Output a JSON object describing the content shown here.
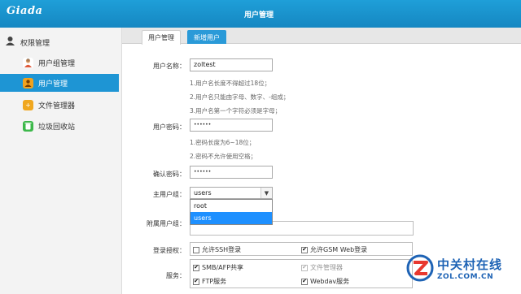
{
  "header": {
    "logo": "Giada",
    "title": "用户管理"
  },
  "sidebar": {
    "section": "权限管理",
    "items": [
      {
        "label": "用户组管理",
        "active": false
      },
      {
        "label": "用户管理",
        "active": true
      },
      {
        "label": "文件管理器",
        "active": false
      },
      {
        "label": "垃圾回收站",
        "active": false
      }
    ]
  },
  "tabs": {
    "current": "用户管理",
    "add": "新增用户"
  },
  "form": {
    "username_label": "用户名称：",
    "username_value": "zoltest",
    "username_hints": [
      "1.用户名长度不得超过18位；",
      "2.用户名只能由字母、数字、-组成；",
      "3.用户名第一个字符必须是字母；"
    ],
    "password_label": "用户密码：",
    "password_value": "••••••",
    "password_hints": [
      "1.密码长度为6~18位；",
      "2.密码不允许使用空格；"
    ],
    "confirm_label": "确认密码：",
    "confirm_value": "••••••",
    "group_label": "主用户组：",
    "group_value": "users",
    "group_options": [
      "root",
      "users"
    ],
    "subgroup_label": "附属用户组：",
    "login_label": "登录授权：",
    "login_ssh": "允许SSH登录",
    "login_gsm": "允许GSM Web登录",
    "service_label": "服务：",
    "svc_smb": "SMB/AFP共享",
    "svc_filemgr": "文件管理器",
    "svc_ftp": "FTP服务",
    "svc_webdav": "Webdav服务"
  },
  "watermark": {
    "cn": "中关村在线",
    "en": "ZOL.COM.CN"
  },
  "colors": {
    "header": "#1f9fd8",
    "active": "#1e95d4",
    "tab_add": "#2a9ad8"
  }
}
